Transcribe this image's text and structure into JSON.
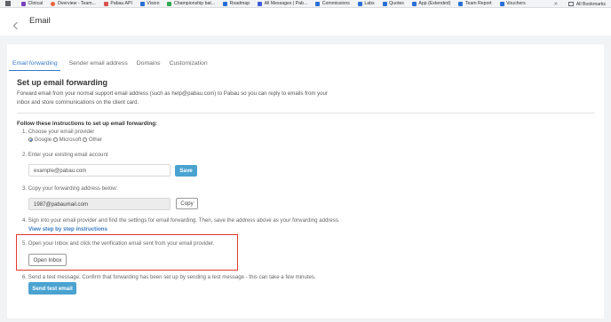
{
  "bookmarks_bar": {
    "items": [
      {
        "label": "Clinical",
        "color": "#7b3fbf"
      },
      {
        "label": "Overview - Team...",
        "color": "#e8643a"
      },
      {
        "label": "Pabau API",
        "color": "#d9534f"
      },
      {
        "label": "Vision",
        "color": "#2a6fd6"
      },
      {
        "label": "Championship bat...",
        "color": "#34a853"
      },
      {
        "label": "Roadmap",
        "color": "#2a6fd6"
      },
      {
        "label": "All Messages | Pab...",
        "color": "#3b5bdb"
      },
      {
        "label": "Commissions",
        "color": "#2a6fd6"
      },
      {
        "label": "Labs",
        "color": "#2a6fd6"
      },
      {
        "label": "Quotes",
        "color": "#2a6fd6"
      },
      {
        "label": "App (Extended)",
        "color": "#2a6fd6"
      },
      {
        "label": "Team Report",
        "color": "#2a6fd6"
      },
      {
        "label": "Vouchers",
        "color": "#2a6fd6"
      }
    ],
    "more": "»",
    "all_bookmarks": "All Bookmarks"
  },
  "header": {
    "title": "Email"
  },
  "tabs": [
    {
      "label": "Email forwarding",
      "active": true
    },
    {
      "label": "Sender email address",
      "active": false
    },
    {
      "label": "Domains",
      "active": false
    },
    {
      "label": "Customization",
      "active": false
    }
  ],
  "main": {
    "section_title": "Set up email forwarding",
    "description": "Forward email from your normal support email address (such as help@pabau.com) to Pabau so you can reply to emails from your inbox and store communications on the client card.",
    "instructions_title": "Follow these instructions to set up email forwarding:",
    "step1": "1. Choose your email provider",
    "providers": [
      {
        "label": "Google",
        "checked": true
      },
      {
        "label": "Microsoft",
        "checked": false
      },
      {
        "label": "Other",
        "checked": false
      }
    ],
    "step2": "2. Enter your existing email account",
    "email_placeholder": "example@pabau.com",
    "save_label": "Save",
    "step3": "3. Copy your forwarding address below:",
    "forwarding_address": "1987@pabaumail.com",
    "copy_label": "Copy",
    "step4": "4. Sign into your email provider and find the settings for email forwarding. Then, save the address above as your forwarding address.",
    "step4_link": "View step by step instructions",
    "step5": "5. Open your Inbox and click the verification email sent from your email provider.",
    "open_inbox_label": "Open Inbox",
    "step6": "6. Send a test message. Confirm that forwarding has been set up by sending a test message - this can take a few minutes.",
    "send_test_label": "Send test email"
  },
  "colors": {
    "accent": "#3576c8",
    "primary_button": "#4aa3d1",
    "highlight_border": "#e03a2e"
  }
}
